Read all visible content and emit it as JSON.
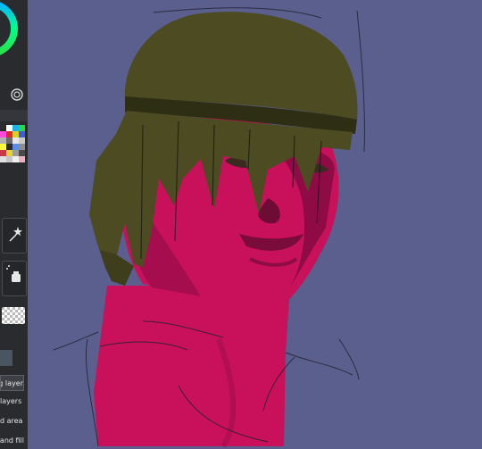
{
  "sidebar": {
    "color_wheel_icon": "color-wheel-icon",
    "target_icon": "target-icon",
    "palette_colors": [
      "#2b2b2b",
      "#ffffff",
      "#1bb3e6",
      "#2bd64f",
      "#fb4bd8",
      "#da2a2a",
      "#d8d02c",
      "#3d5bd6",
      "#b0b0b0",
      "#6b6b6b",
      "#e7e7e7",
      "#c9c9c9",
      "#fffb3d",
      "#2a2a2a",
      "#5d8de3",
      "#8d8d8d",
      "#c83a47",
      "#e3d23a",
      "#9a9a9a",
      "#4a4a4a",
      "#e1e1e1",
      "#c7c7c7",
      "#f0f0f0",
      "#f0afbf"
    ],
    "tools": [
      {
        "icon": "magic-wand-icon"
      },
      {
        "icon": "spray-bucket-icon"
      }
    ],
    "transparency_icon": "transparency-checker-icon",
    "layer_menu": [
      "ng layer",
      "layers",
      "d area",
      "and fill"
    ]
  },
  "canvas": {
    "background": "#5b5f8e",
    "artwork": "painted-portrait"
  }
}
